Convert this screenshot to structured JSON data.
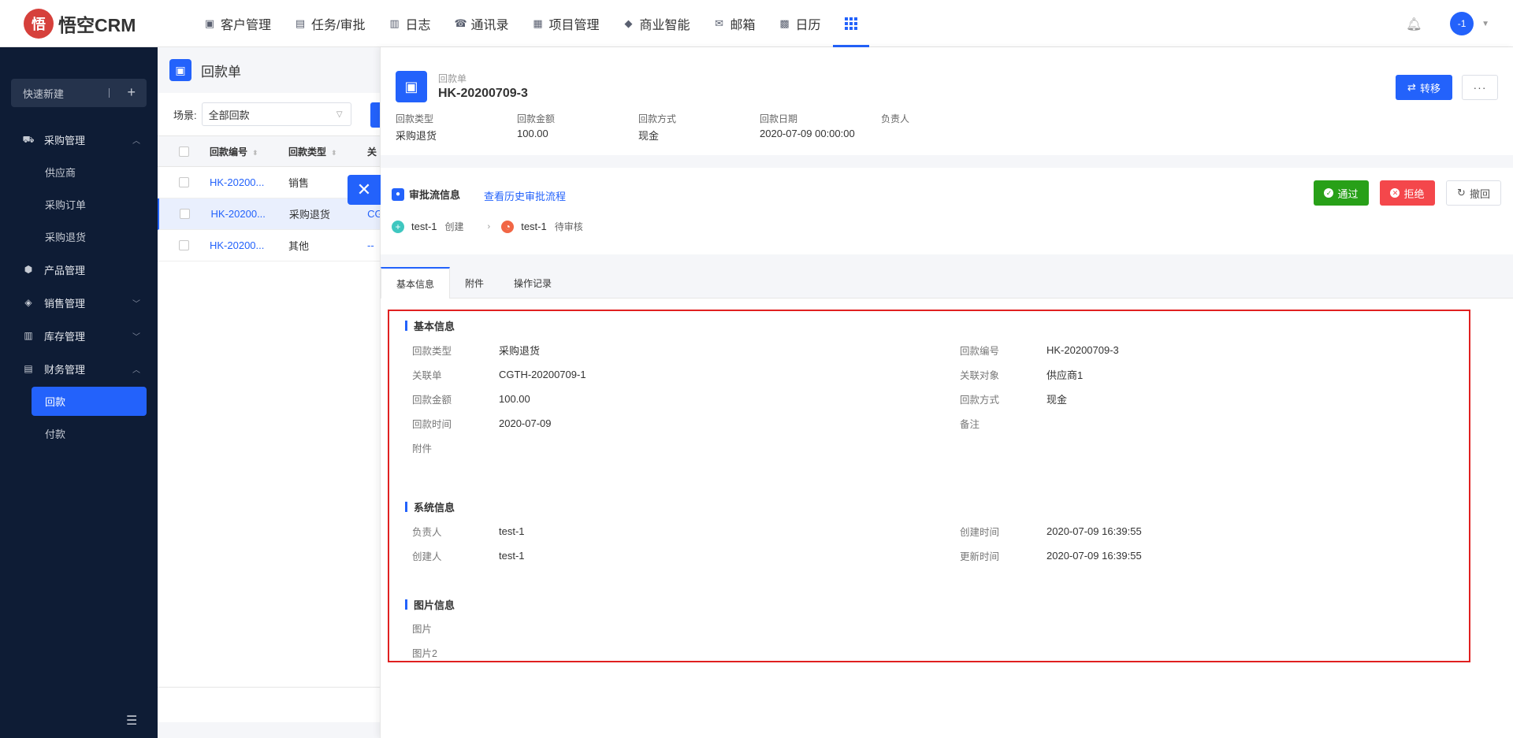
{
  "app": {
    "logo_badge": "悟",
    "logo_text": "悟空CRM",
    "nav": [
      {
        "icon": "contacts-icon",
        "glyph": "▣",
        "label": "客户管理"
      },
      {
        "icon": "briefcase-icon",
        "glyph": "▤",
        "label": "任务/审批"
      },
      {
        "icon": "log-icon",
        "glyph": "▥",
        "label": "日志"
      },
      {
        "icon": "phonebook-icon",
        "glyph": "☎",
        "label": "通讯录"
      },
      {
        "icon": "project-icon",
        "glyph": "▦",
        "label": "项目管理"
      },
      {
        "icon": "bi-icon",
        "glyph": "◆",
        "label": "商业智能"
      },
      {
        "icon": "mail-icon",
        "glyph": "✉",
        "label": "邮箱"
      },
      {
        "icon": "calendar-icon",
        "glyph": "▩",
        "label": "日历"
      }
    ],
    "avatar": "-1",
    "accent": "#2362fb"
  },
  "sidebar": {
    "quick_new": "快速新建",
    "groups": [
      {
        "label": "采购管理",
        "icon": "cart-icon",
        "glyph": "⛟",
        "chev": "^"
      },
      {
        "label": "供应商"
      },
      {
        "label": "采购订单"
      },
      {
        "label": "采购退货"
      },
      {
        "label": "产品管理",
        "icon": "product-icon",
        "glyph": "⬢"
      },
      {
        "label": "销售管理",
        "icon": "tag-icon",
        "glyph": "◈",
        "chev": "v"
      },
      {
        "label": "库存管理",
        "icon": "warehouse-icon",
        "glyph": "▥",
        "chev": "v"
      },
      {
        "label": "财务管理",
        "icon": "finance-icon",
        "glyph": "▤",
        "chev": "^"
      },
      {
        "label": "回款"
      },
      {
        "label": "付款"
      }
    ]
  },
  "list": {
    "title": "回款单",
    "scene_label": "场景:",
    "scene_value": "全部回款",
    "columns": [
      "回款编号",
      "回款类型",
      "关"
    ],
    "rows": [
      {
        "no": "HK-20200...",
        "type": "销售",
        "rel": "",
        "selected": false
      },
      {
        "no": "HK-20200...",
        "type": "采购退货",
        "rel": "CG",
        "selected": true
      },
      {
        "no": "HK-20200...",
        "type": "其他",
        "rel": "--",
        "selected": false
      }
    ]
  },
  "detail": {
    "kind": "回款单",
    "title": "HK-20200709-3",
    "transfer_label": "转移",
    "more_label": "···",
    "summary": [
      {
        "label": "回款类型",
        "value": "采购退货"
      },
      {
        "label": "回款金额",
        "value": "100.00"
      },
      {
        "label": "回款方式",
        "value": "现金"
      },
      {
        "label": "回款日期",
        "value": "2020-07-09 00:00:00"
      },
      {
        "label": "负责人",
        "value": ""
      }
    ],
    "flow": {
      "title": "审批流信息",
      "history_link": "查看历史审批流程",
      "pass": "通过",
      "reject": "拒绝",
      "revoke": "撤回",
      "steps": [
        {
          "user": "test-1",
          "status": "创建",
          "color": "#3fc7c0",
          "glyph": "+"
        },
        {
          "user": "test-1",
          "status": "待审核",
          "color": "#f16645",
          "glyph": "◔"
        }
      ]
    },
    "tabs": [
      "基本信息",
      "附件",
      "操作记录"
    ],
    "sections": {
      "basic": {
        "title": "基本信息",
        "left": [
          {
            "label": "回款类型",
            "value": "采购退货"
          },
          {
            "label": "关联单",
            "value": "CGTH-20200709-1",
            "link": true
          },
          {
            "label": "回款金额",
            "value": "100.00"
          },
          {
            "label": "回款时间",
            "value": "2020-07-09"
          },
          {
            "label": "附件",
            "value": ""
          }
        ],
        "right": [
          {
            "label": "回款编号",
            "value": "HK-20200709-3"
          },
          {
            "label": "关联对象",
            "value": "供应商1",
            "link": true
          },
          {
            "label": "回款方式",
            "value": "现金"
          },
          {
            "label": "备注",
            "value": ""
          }
        ]
      },
      "system": {
        "title": "系统信息",
        "left": [
          {
            "label": "负责人",
            "value": "test-1"
          },
          {
            "label": "创建人",
            "value": "test-1"
          }
        ],
        "right": [
          {
            "label": "创建时间",
            "value": "2020-07-09 16:39:55"
          },
          {
            "label": "更新时间",
            "value": "2020-07-09 16:39:55"
          }
        ]
      },
      "images": {
        "title": "图片信息",
        "left": [
          {
            "label": "图片",
            "value": ""
          },
          {
            "label": "图片2",
            "value": ""
          }
        ]
      }
    }
  }
}
